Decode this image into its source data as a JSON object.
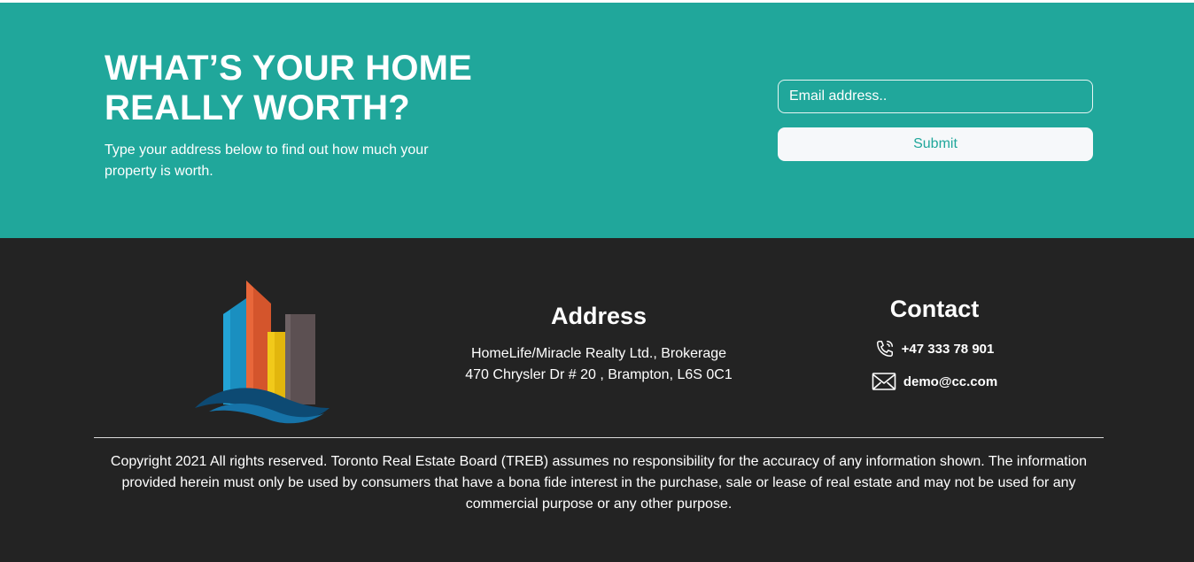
{
  "cta": {
    "title": "WHAT’S YOUR HOME REALLY WORTH?",
    "subtitle": "Type your address below to find out how much your property is worth.",
    "email_placeholder": "Email address..",
    "submit_label": "Submit"
  },
  "footer": {
    "address": {
      "title": "Address",
      "line1": "HomeLife/Miracle Realty Ltd., Brokerage",
      "line2": "470 Chrysler Dr # 20 , Brampton, L6S 0C1"
    },
    "contact": {
      "title": "Contact",
      "phone": "+47 333 78 901",
      "email": "demo@cc.com"
    },
    "copyright": "Copyright 2021 All rights reserved. Toronto Real Estate Board (TREB) assumes no responsibility for the accuracy of any information shown. The information provided herein must only be used by consumers that have a bona fide interest in the purchase, sale or lease of real estate and may not be used for any commercial purpose or any other purpose."
  },
  "colors": {
    "teal": "#20a79b",
    "footer_bg": "#232323",
    "white": "#ffffff"
  },
  "icons": {
    "logo": "building-wave-logo",
    "phone": "phone-icon",
    "email": "envelope-icon"
  }
}
